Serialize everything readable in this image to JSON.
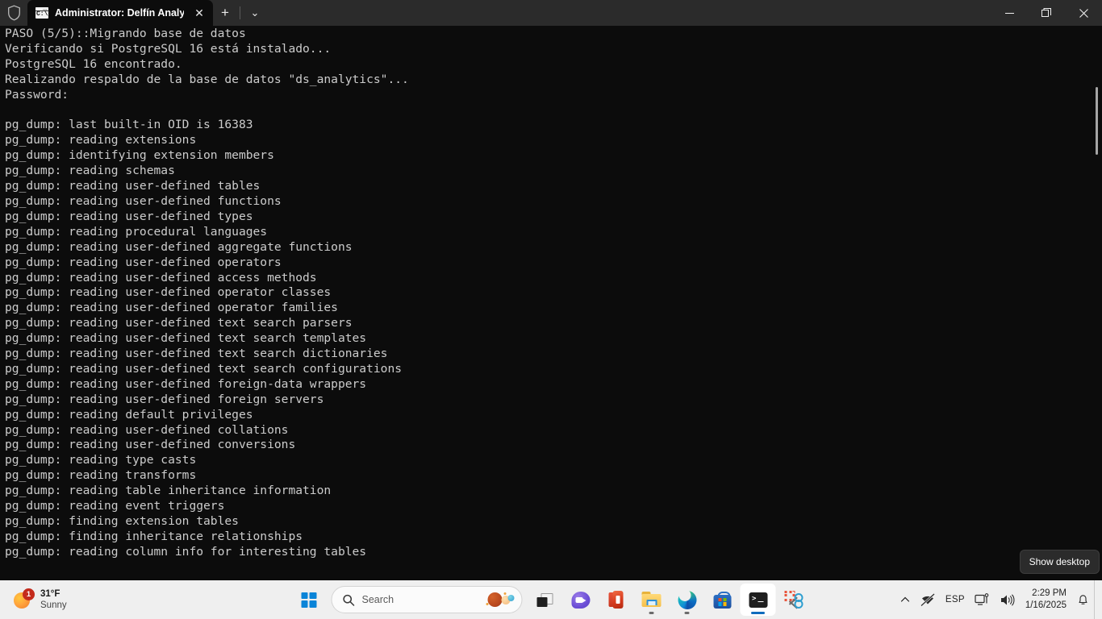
{
  "window": {
    "shield_icon": "shield-icon",
    "tab": {
      "icon": "console-icon",
      "title": "Administrator:  Delfín Analyti",
      "close_label": "✕"
    },
    "new_tab_label": "+",
    "dropdown_label": "⌄",
    "controls": {
      "minimize": "—",
      "maximize": "❐",
      "close": "✕"
    }
  },
  "terminal": {
    "foreground": "#cccccc",
    "background": "#0c0c0c",
    "lines": [
      "PASO (5/5)::Migrando base de datos",
      "Verificando si PostgreSQL 16 está instalado...",
      "PostgreSQL 16 encontrado.",
      "Realizando respaldo de la base de datos \"ds_analytics\"...",
      "Password:",
      "",
      "pg_dump: last built-in OID is 16383",
      "pg_dump: reading extensions",
      "pg_dump: identifying extension members",
      "pg_dump: reading schemas",
      "pg_dump: reading user-defined tables",
      "pg_dump: reading user-defined functions",
      "pg_dump: reading user-defined types",
      "pg_dump: reading procedural languages",
      "pg_dump: reading user-defined aggregate functions",
      "pg_dump: reading user-defined operators",
      "pg_dump: reading user-defined access methods",
      "pg_dump: reading user-defined operator classes",
      "pg_dump: reading user-defined operator families",
      "pg_dump: reading user-defined text search parsers",
      "pg_dump: reading user-defined text search templates",
      "pg_dump: reading user-defined text search dictionaries",
      "pg_dump: reading user-defined text search configurations",
      "pg_dump: reading user-defined foreign-data wrappers",
      "pg_dump: reading user-defined foreign servers",
      "pg_dump: reading default privileges",
      "pg_dump: reading user-defined collations",
      "pg_dump: reading user-defined conversions",
      "pg_dump: reading type casts",
      "pg_dump: reading transforms",
      "pg_dump: reading table inheritance information",
      "pg_dump: reading event triggers",
      "pg_dump: finding extension tables",
      "pg_dump: finding inheritance relationships",
      "pg_dump: reading column info for interesting tables"
    ]
  },
  "tooltip": {
    "show_desktop": "Show desktop"
  },
  "taskbar": {
    "weather": {
      "temperature": "31°F",
      "condition": "Sunny",
      "badge_count": "1",
      "icon": "sun-icon"
    },
    "start": {
      "label": "Start",
      "icon": "windows-logo-icon"
    },
    "search": {
      "placeholder": "Search",
      "icon": "search-icon",
      "copilot_icon": "copilot-icon"
    },
    "apps": [
      {
        "name": "task-view",
        "icon": "task-view-icon",
        "running": false
      },
      {
        "name": "chat",
        "icon": "chat-icon",
        "running": false
      },
      {
        "name": "office",
        "icon": "office-icon",
        "running": false
      },
      {
        "name": "file-explorer",
        "icon": "folder-icon",
        "running": true
      },
      {
        "name": "edge",
        "icon": "edge-icon",
        "running": true
      },
      {
        "name": "microsoft-store",
        "icon": "store-icon",
        "running": false
      },
      {
        "name": "windows-terminal",
        "icon": "terminal-icon",
        "running": true,
        "active": true
      },
      {
        "name": "snipping-tool",
        "icon": "scissors-icon",
        "running": false
      }
    ],
    "tray": {
      "overflow_icon": "chevron-up-icon",
      "network_icon": "network-disconnected-icon",
      "language": "ESP",
      "monitor_icon": "monitor-icon",
      "volume_icon": "speaker-icon",
      "time": "2:29 PM",
      "date": "1/16/2025",
      "notification_icon": "bell-icon"
    }
  }
}
